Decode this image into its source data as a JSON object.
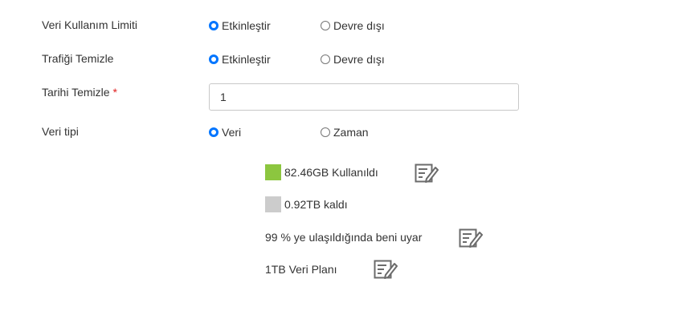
{
  "form": {
    "data_limit": {
      "label": "Veri Kullanım Limiti",
      "option_enable": "Etkinleştir",
      "option_disable": "Devre dışı",
      "selected": "enable"
    },
    "clear_traffic": {
      "label": "Trafiği Temizle",
      "option_enable": "Etkinleştir",
      "option_disable": "Devre dışı",
      "selected": "enable"
    },
    "clear_date": {
      "label": "Tarihi Temizle",
      "required_mark": "*",
      "value": "1"
    },
    "data_type": {
      "label": "Veri tipi",
      "option_data": "Veri",
      "option_time": "Zaman",
      "selected": "data"
    }
  },
  "usage": {
    "used_text": "82.46GB Kullanıldı",
    "used_color": "#8cc63f",
    "remaining_text": "0.92TB kaldı",
    "remaining_color": "#cccccc",
    "alert_text": "99 % ye ulaşıldığında beni uyar",
    "plan_text": "1TB Veri Planı"
  },
  "icons": {
    "edit": "edit-icon"
  },
  "colors": {
    "radio_accent": "#0075ff",
    "required": "#e02020"
  }
}
